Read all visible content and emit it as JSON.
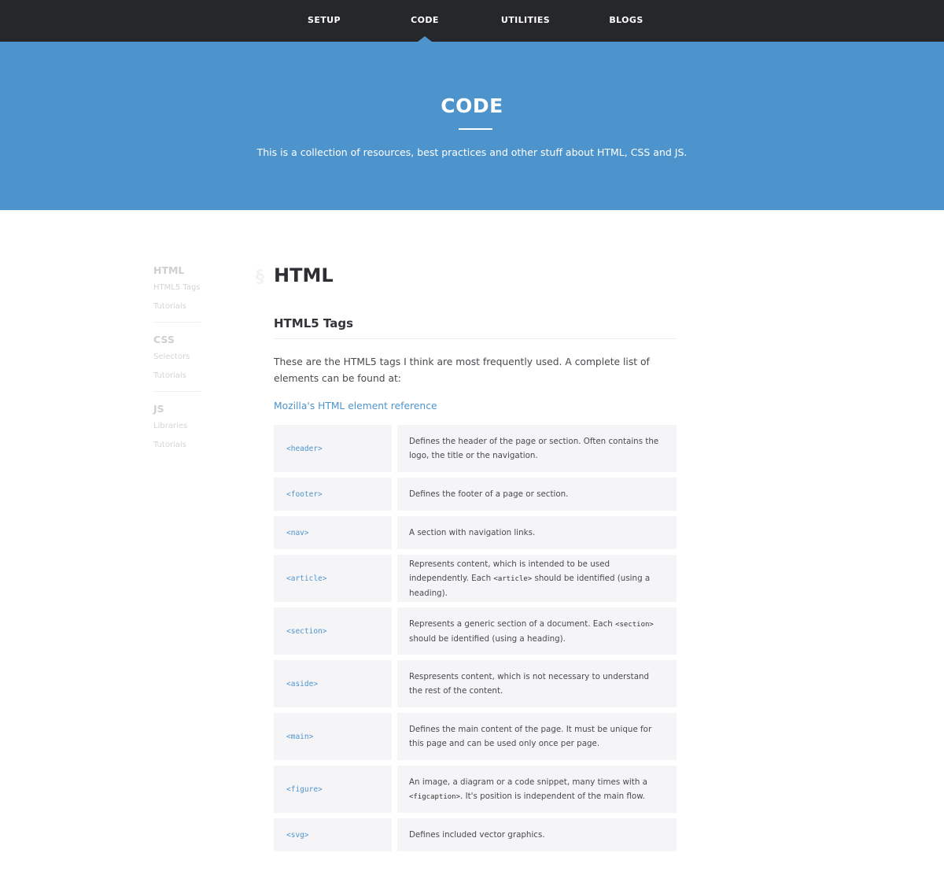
{
  "nav": {
    "items": [
      {
        "label": "SETUP"
      },
      {
        "label": "CODE"
      },
      {
        "label": "UTILITIES"
      },
      {
        "label": "BLOGS"
      }
    ],
    "active": "CODE"
  },
  "hero": {
    "title": "CODE",
    "subtitle": "This is a collection of resources, best practices and other stuff about HTML, CSS and JS."
  },
  "sidebar": {
    "groups": [
      {
        "title": "HTML",
        "links": [
          "HTML5 Tags",
          "Tutorials"
        ]
      },
      {
        "title": "CSS",
        "links": [
          "Selectors",
          "Tutorials"
        ]
      },
      {
        "title": "JS",
        "links": [
          "Libraries",
          "Tutorials"
        ]
      }
    ]
  },
  "content": {
    "anchor_symbol": "§",
    "heading": "HTML",
    "subheading": "HTML5 Tags",
    "intro": "These are the HTML5 tags I think are most frequently used. A complete list of elements can be found at:",
    "reference_link": "Mozilla's HTML element reference",
    "tags": [
      {
        "tag": "<header>",
        "desc_before": "Defines the header of the page or section. Often contains the logo, the title or the navigation.",
        "code": "",
        "desc_after": ""
      },
      {
        "tag": "<footer>",
        "desc_before": "Defines the footer of a page or section.",
        "code": "",
        "desc_after": ""
      },
      {
        "tag": "<nav>",
        "desc_before": "A section with navigation links.",
        "code": "",
        "desc_after": ""
      },
      {
        "tag": "<article>",
        "desc_before": "Represents content, which is intended to be used independently. Each ",
        "code": "<article>",
        "desc_after": " should be identified (using a heading)."
      },
      {
        "tag": "<section>",
        "desc_before": "Represents a generic section of a document. Each ",
        "code": "<section>",
        "desc_after": " should be identified (using a heading)."
      },
      {
        "tag": "<aside>",
        "desc_before": "Respresents content, which is not necessary to understand the rest of the content.",
        "code": "",
        "desc_after": ""
      },
      {
        "tag": "<main>",
        "desc_before": "Defines the main content of the page. It must be unique for this page and can be used only once per page.",
        "code": "",
        "desc_after": ""
      },
      {
        "tag": "<figure>",
        "desc_before": "An image, a diagram or a code snippet, many times with a ",
        "code": "<figcaption>",
        "desc_after": ". It's position is independent of the main flow."
      },
      {
        "tag": "<svg>",
        "desc_before": "Defines included vector graphics.",
        "code": "",
        "desc_after": ""
      }
    ]
  },
  "colors": {
    "nav_bg": "#26272b",
    "accent": "#4e94cc",
    "cell_bg": "#f5f5f8"
  }
}
